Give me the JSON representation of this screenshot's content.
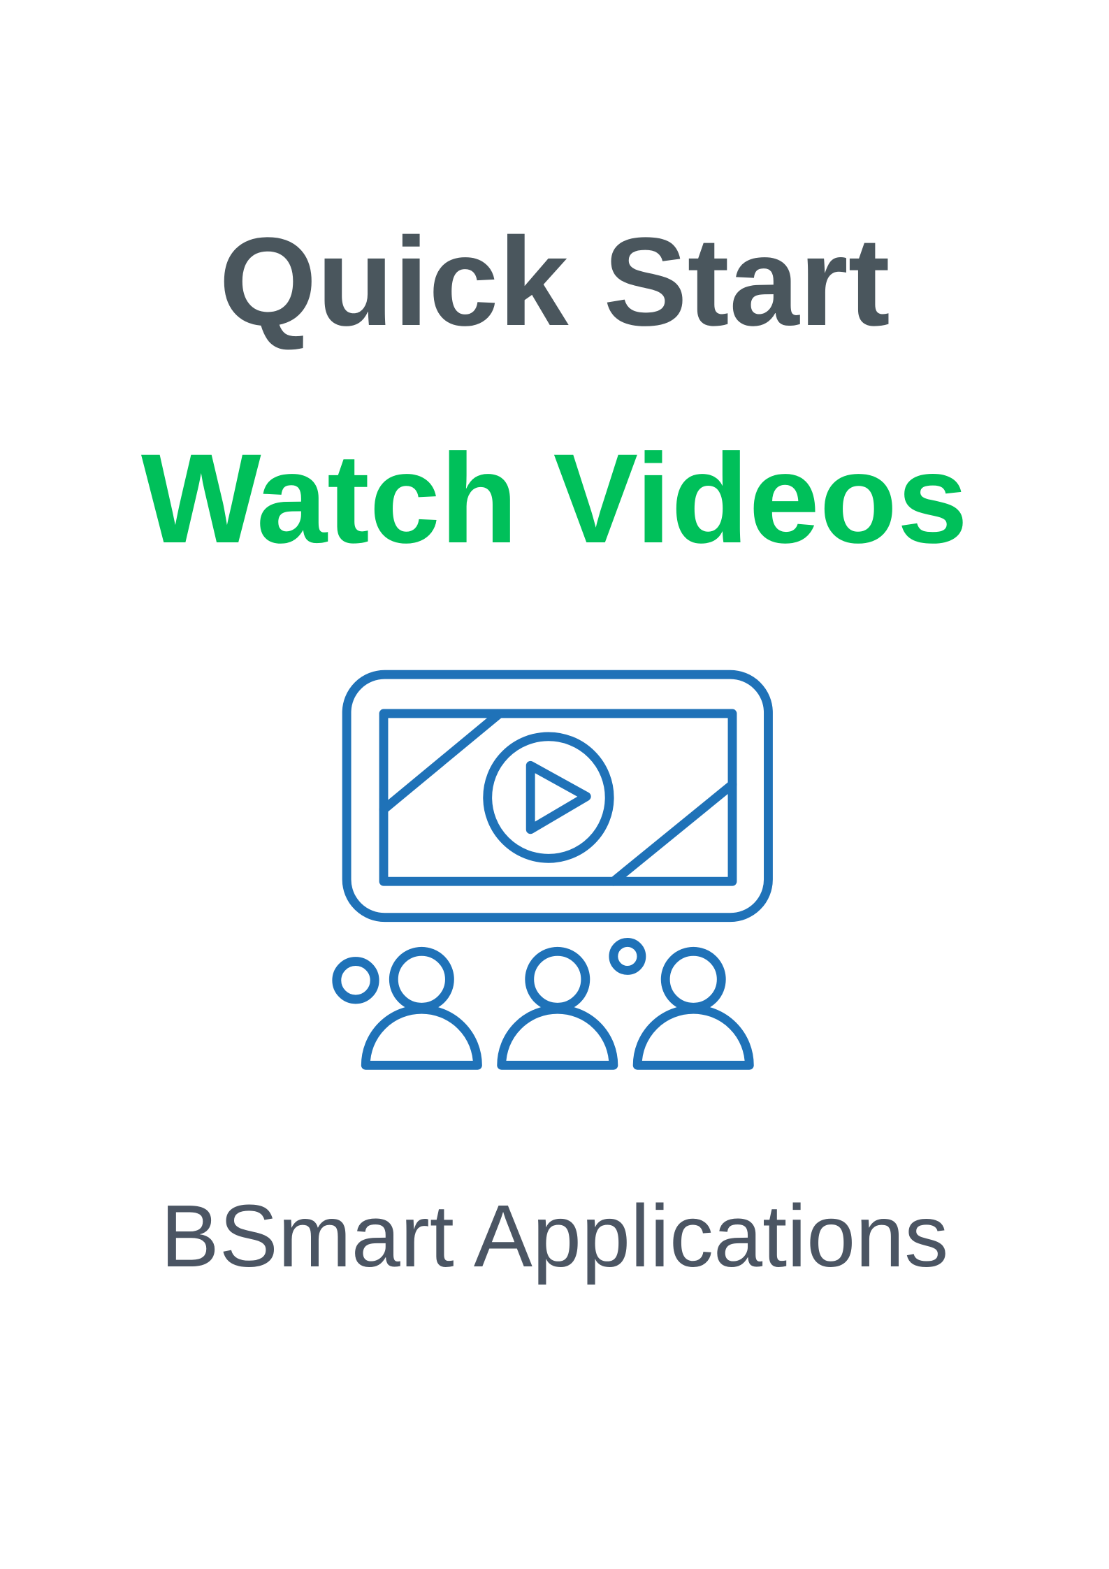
{
  "title": "Quick Start",
  "subtitle": "Watch Videos",
  "brand": "BSmart Applications",
  "icon": "video-presentation-audience-icon",
  "colors": {
    "title": "#4a565d",
    "subtitle": "#00c05a",
    "icon": "#1f72b8",
    "brand": "#4b5563"
  }
}
